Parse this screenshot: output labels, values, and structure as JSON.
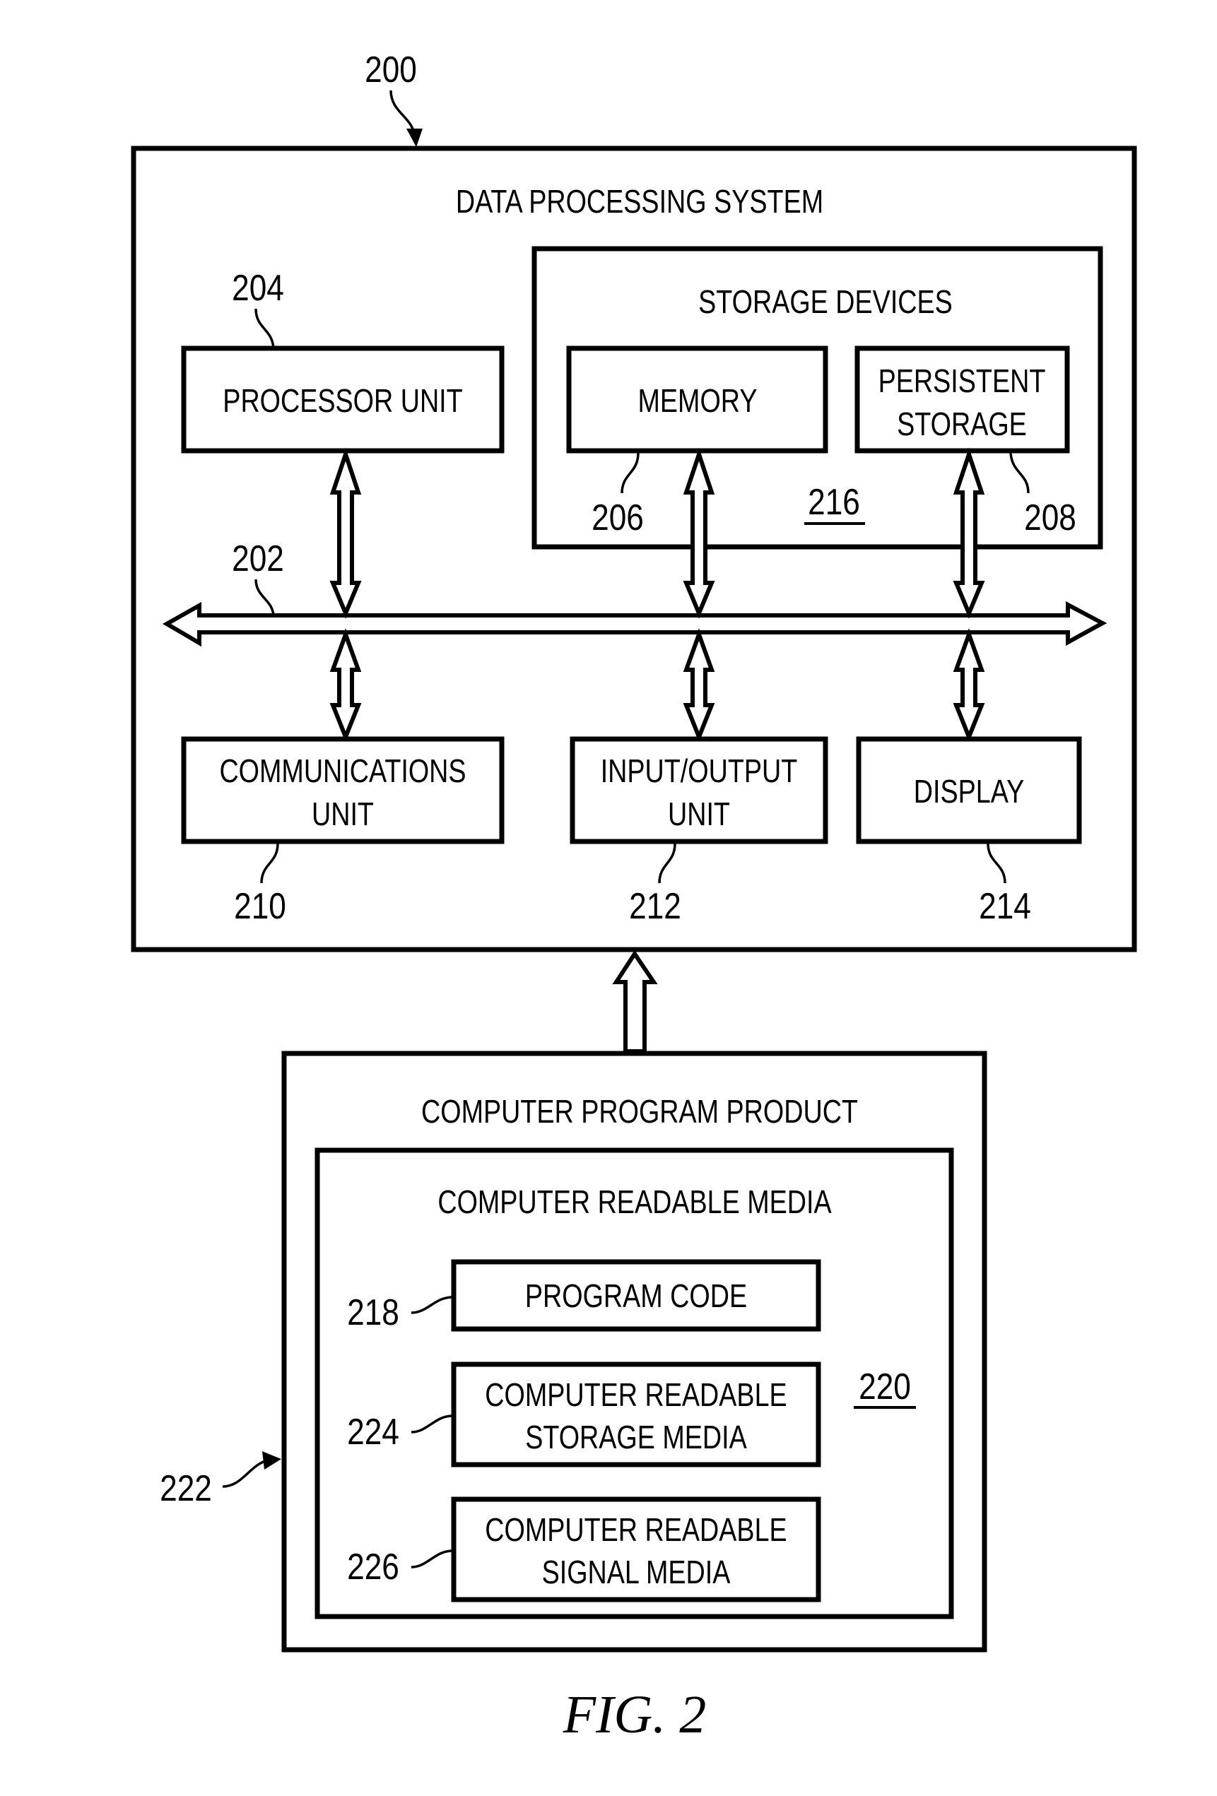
{
  "figure": {
    "caption": "FIG. 2",
    "ref_system": "200"
  },
  "data_processing_system": {
    "title": "DATA PROCESSING SYSTEM",
    "bus_ref": "202",
    "processor_unit": {
      "label": "PROCESSOR UNIT",
      "ref": "204"
    },
    "storage_devices": {
      "title": "STORAGE DEVICES",
      "ref": "216",
      "memory": {
        "label": "MEMORY",
        "ref": "206"
      },
      "persistent_storage": {
        "label_line1": "PERSISTENT",
        "label_line2": "STORAGE",
        "ref": "208"
      }
    },
    "communications_unit": {
      "label_line1": "COMMUNICATIONS",
      "label_line2": "UNIT",
      "ref": "210"
    },
    "input_output_unit": {
      "label_line1": "INPUT/OUTPUT",
      "label_line2": "UNIT",
      "ref": "212"
    },
    "display": {
      "label": "DISPLAY",
      "ref": "214"
    }
  },
  "computer_program_product": {
    "title": "COMPUTER PROGRAM PRODUCT",
    "ref": "222",
    "computer_readable_media": {
      "title": "COMPUTER READABLE MEDIA",
      "ref": "220",
      "program_code": {
        "label": "PROGRAM CODE",
        "ref": "218"
      },
      "storage_media": {
        "label_line1": "COMPUTER READABLE",
        "label_line2": "STORAGE MEDIA",
        "ref": "224"
      },
      "signal_media": {
        "label_line1": "COMPUTER READABLE",
        "label_line2": "SIGNAL MEDIA",
        "ref": "226"
      }
    }
  }
}
